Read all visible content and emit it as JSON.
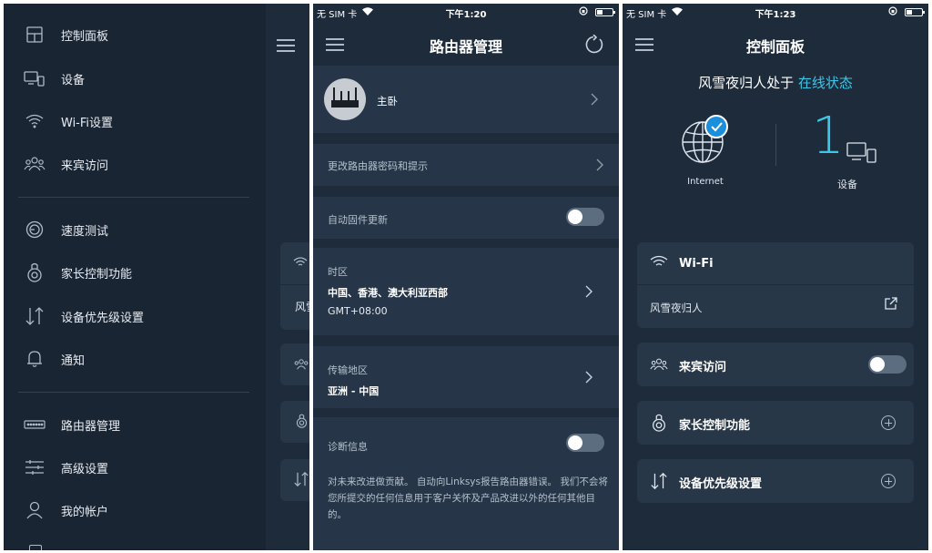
{
  "menu": {
    "items": [
      {
        "label": "控制面板",
        "icon": "dashboard-icon"
      },
      {
        "label": "设备",
        "icon": "devices-icon"
      },
      {
        "label": "Wi-Fi设置",
        "icon": "wifi-icon"
      },
      {
        "label": "来宾访问",
        "icon": "guest-icon"
      },
      {
        "label": "速度测试",
        "icon": "speedometer-icon"
      },
      {
        "label": "家长控制功能",
        "icon": "parental-control-icon"
      },
      {
        "label": "设备优先级设置",
        "icon": "priority-arrows-icon"
      },
      {
        "label": "通知",
        "icon": "bell-icon"
      },
      {
        "label": "路由器管理",
        "icon": "router-icon"
      },
      {
        "label": "高级设置",
        "icon": "sliders-icon"
      },
      {
        "label": "我的帐户",
        "icon": "user-icon"
      }
    ],
    "peek_text": "风雪"
  },
  "router_admin": {
    "status": {
      "carrier": "无 SIM 卡",
      "time": "下午1:20"
    },
    "title": "路由器管理",
    "router_name": "主卧",
    "change_password": "更改路由器密码和提示",
    "auto_firmware": "自动固件更新",
    "timezone": {
      "label": "时区",
      "value": "中国、香港、澳大利亚西部",
      "offset": "GMT+08:00"
    },
    "region": {
      "label": "传输地区",
      "value": "亚洲 - 中国"
    },
    "diagnostics": {
      "label": "诊断信息",
      "description": "对未来改进做贡献。 自动向Linksys报告路由器错误。 我们不会将您所提交的任何信息用于客户关怀及产品改进以外的任何其他目的。"
    }
  },
  "dashboard": {
    "status": {
      "carrier": "无 SIM 卡",
      "time": "下午1:23"
    },
    "title": "控制面板",
    "network_name": "风雪夜归人处于",
    "network_state": "在线状态",
    "device_count": "1",
    "internet_label": "Internet",
    "devices_label": "设备",
    "wifi": {
      "title": "Wi-Fi",
      "ssid": "风雪夜归人"
    },
    "guest": {
      "title": "来宾访问"
    },
    "parental": {
      "title": "家长控制功能"
    },
    "priority": {
      "title": "设备优先级设置"
    }
  },
  "colors": {
    "accent": "#3cc6e8",
    "panel_bg": "#1d2b3b",
    "card_bg": "#273748",
    "menu_bg": "#1a2534"
  }
}
